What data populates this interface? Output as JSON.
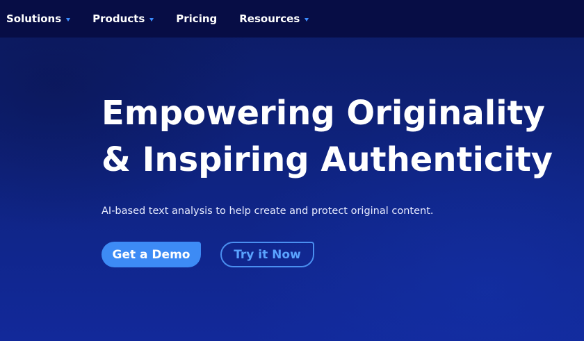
{
  "nav": {
    "items": [
      {
        "label": "Solutions",
        "has_dropdown": true
      },
      {
        "label": "Products",
        "has_dropdown": true
      },
      {
        "label": "Pricing",
        "has_dropdown": false
      },
      {
        "label": "Resources",
        "has_dropdown": true
      }
    ],
    "dropdown_icon": "caret-down-icon"
  },
  "hero": {
    "title_line1": "Empowering Originality",
    "title_line2": "& Inspiring Authenticity",
    "subtitle": "AI-based text analysis to help create and protect original content.",
    "primary_cta": "Get a Demo",
    "secondary_cta": "Try it Now"
  },
  "colors": {
    "nav_bg": "#070d45",
    "hero_bg": "#0f2483",
    "accent": "#3d8bf5",
    "text": "#ffffff"
  }
}
